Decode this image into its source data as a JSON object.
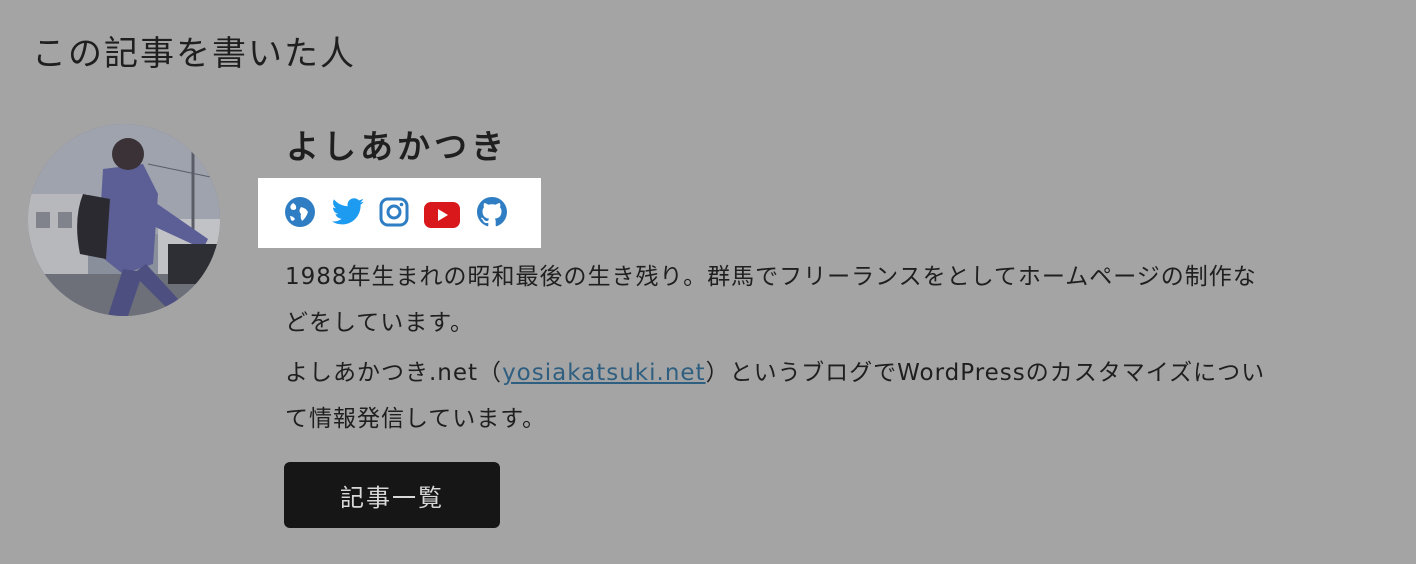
{
  "section": {
    "heading": "この記事を書いた人"
  },
  "author": {
    "name": "よしあかつき",
    "avatar_alt": "",
    "social": [
      {
        "icon": "globe-icon",
        "color": "#2f7ec4"
      },
      {
        "icon": "twitter-icon",
        "color": "#1d9bf0"
      },
      {
        "icon": "instagram-icon",
        "color": "#2f7ec4"
      },
      {
        "icon": "youtube-icon",
        "color": "#d9181c"
      },
      {
        "icon": "github-icon",
        "color": "#2f7ec4"
      }
    ],
    "bio": {
      "p1": "1988年生まれの昭和最後の生き残り。群馬でフリーランスをとしてホームページの制作などをしています。",
      "p2_before": "よしあかつき.net（",
      "p2_link": "yosiakatsuki.net",
      "p2_after": "）というブログでWordPressのカスタマイズについて情報発信しています。"
    },
    "button_label": "記事一覧"
  },
  "colors": {
    "background": "#a4a4a4",
    "button": "#161616",
    "link": "#2f5f80",
    "highlight_box": "#ffffff"
  }
}
